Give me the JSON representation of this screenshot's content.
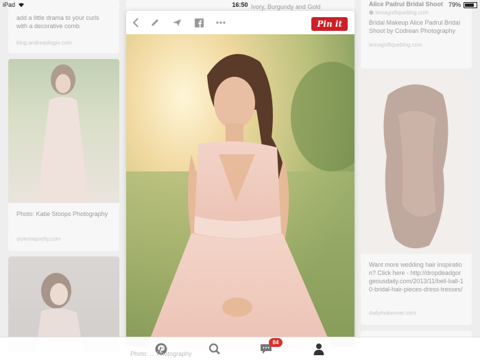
{
  "status_bar": {
    "device": "iPad",
    "time": "16:50",
    "battery": "79%"
  },
  "background_pins": {
    "left_top": {
      "text": "add a little drama to your curls with a decorative comb",
      "source": "blog.andreaologie.com"
    },
    "left_mid": {
      "text": "Photo: Katie Stoops Photography",
      "source": "stylemepretty.com"
    },
    "center_top": {
      "title": "Ivory, Burgundy and Gold"
    },
    "right_top": {
      "title": "Alice Padrul Bridal Shoot",
      "source_badge": "lemagnifiqueblog.com",
      "text": "Bridal Makeup Alice Padrul Bridal Shoot by Codrean Photography",
      "source": "lemagnifiqueblog.com"
    },
    "right_mid": {
      "text": "Want more wedding hair inspiration? Click here - http://dropdeadgorgeousdaily.com/2013/11/bell-ball-10-bridal-hair-pieces-dress-tresses/",
      "source": "dailymakeover.com"
    }
  },
  "modal": {
    "toolbar": {
      "back_icon": "chevron-left-icon",
      "edit_icon": "pencil-icon",
      "send_icon": "paper-plane-icon",
      "facebook_icon": "facebook-icon",
      "more_icon": "ellipsis-icon",
      "pin_it_label": "Pin it",
      "pin_it_color": "#cb2027"
    }
  },
  "tabbar": {
    "home_icon": "pinterest-icon",
    "search_icon": "search-icon",
    "messages_icon": "chat-bubble-icon",
    "messages_badge": "84",
    "profile_icon": "person-icon",
    "ghost_caption": "Photo: ... Photography"
  }
}
